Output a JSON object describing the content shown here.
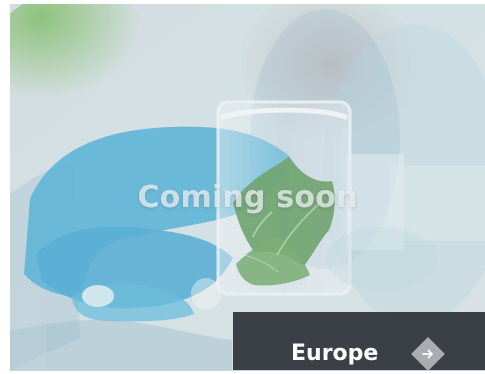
{
  "card": {
    "overlay_text": "Coming soon",
    "region": "Europe"
  },
  "icons": {
    "photo": "lab-beaker-photo",
    "arrow": "arrow-right-icon"
  },
  "colors": {
    "bar": "#2d3237",
    "arrow_button": "#a9acb0",
    "glove": "#35a9d7",
    "plant": "#4f8d49"
  }
}
